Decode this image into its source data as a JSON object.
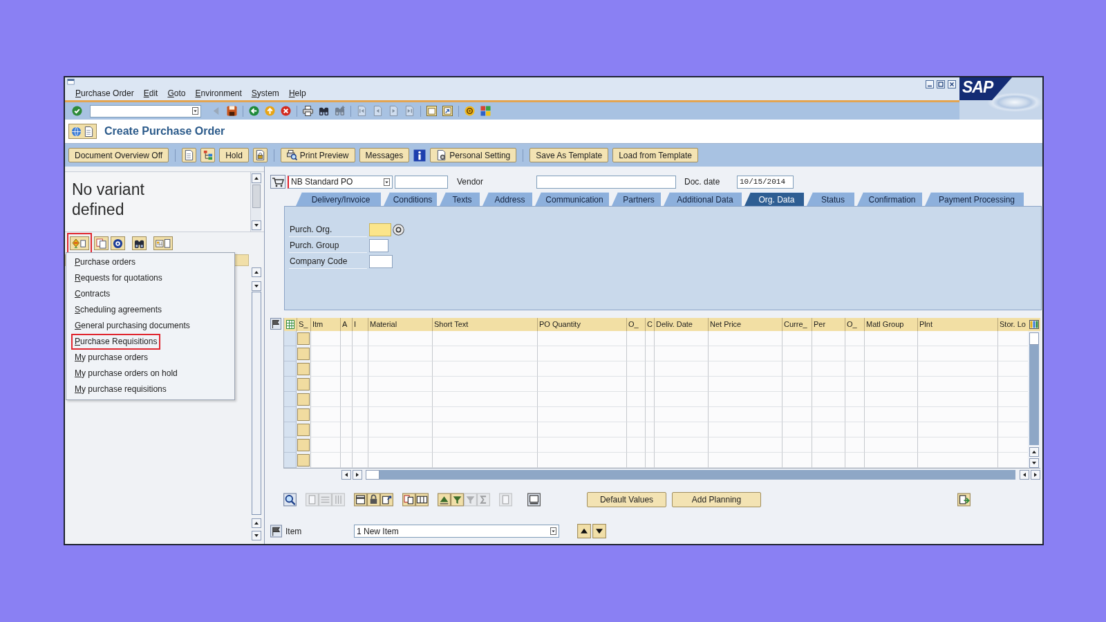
{
  "window": {
    "menu": [
      "Purchase Order",
      "Edit",
      "Goto",
      "Environment",
      "System",
      "Help"
    ],
    "logo": "SAP"
  },
  "system_toolbar": [
    {
      "disabled": false
    },
    {
      "disabled": true
    },
    {
      "disabled": false
    },
    {
      "disabled": false
    },
    {
      "disabled": false
    },
    {
      "disabled": false
    },
    {
      "disabled": false
    },
    {
      "disabled": false
    },
    {
      "disabled": true
    },
    {
      "disabled": true
    },
    {
      "disabled": true
    },
    {
      "disabled": true
    },
    {
      "disabled": true
    },
    {
      "disabled": false
    },
    {
      "disabled": false
    },
    {
      "disabled": false
    },
    {
      "disabled": false
    }
  ],
  "title": "Create Purchase Order",
  "app_toolbar": [
    "Document Overview Off",
    "Hold",
    "Print Preview",
    "Messages",
    "Personal Setting",
    "Save As Template",
    "Load from Template"
  ],
  "variant_panel": {
    "message": "No variant defined"
  },
  "nav_toolbar": [
    {
      "highlighted": true
    },
    {
      "highlighted": false
    },
    {
      "highlighted": false
    },
    {
      "highlighted": false
    },
    {
      "highlighted": false
    }
  ],
  "nav_menu": [
    {
      "label": "Purchase orders",
      "highlighted": false
    },
    {
      "label": "Requests for quotations",
      "highlighted": false
    },
    {
      "label": "Contracts",
      "highlighted": false
    },
    {
      "label": "Scheduling agreements",
      "highlighted": false
    },
    {
      "label": "General purchasing documents",
      "highlighted": false
    },
    {
      "label": "Purchase Requisitions",
      "highlighted": true
    },
    {
      "label": "My purchase orders",
      "highlighted": false
    },
    {
      "label": "My purchase orders on hold",
      "highlighted": false
    },
    {
      "label": "My purchase requisitions",
      "highlighted": false
    }
  ],
  "header": {
    "document_type": "NB Standard PO",
    "vendor_label": "Vendor",
    "doc_date_label": "Doc. date",
    "doc_date": "10/15/2014"
  },
  "tabs": [
    {
      "label": "Delivery/Invoice",
      "selected": false
    },
    {
      "label": "Conditions",
      "selected": false
    },
    {
      "label": "Texts",
      "selected": false
    },
    {
      "label": "Address",
      "selected": false
    },
    {
      "label": "Communication",
      "selected": false
    },
    {
      "label": "Partners",
      "selected": false
    },
    {
      "label": "Additional Data",
      "selected": false
    },
    {
      "label": "Org. Data",
      "selected": true
    },
    {
      "label": "Status",
      "selected": false
    },
    {
      "label": "Confirmation",
      "selected": false
    },
    {
      "label": "Payment Processing",
      "selected": false
    }
  ],
  "org_data": [
    {
      "label": "Purch. Org.",
      "focused": true
    },
    {
      "label": "Purch. Group",
      "focused": false
    },
    {
      "label": "Company Code",
      "focused": false
    }
  ],
  "items_table": {
    "columns": [
      "S_",
      "Itm",
      "A",
      "I",
      "Material",
      "Short Text",
      "PO Quantity",
      "O_",
      "C",
      "Deliv. Date",
      "Net Price",
      "Curre_",
      "Per",
      "O_",
      "Matl Group",
      "Plnt",
      "Stor. Lo"
    ]
  },
  "item_toolbar": {
    "icons": [
      {
        "disabled": false
      },
      {
        "disabled": true
      },
      {
        "disabled": true
      },
      {
        "disabled": true
      },
      {
        "disabled": false
      },
      {
        "disabled": false
      },
      {
        "disabled": false
      },
      {
        "disabled": false
      },
      {
        "disabled": false
      },
      {
        "disabled": false
      },
      {
        "disabled": false
      },
      {
        "disabled": true
      },
      {
        "disabled": true
      },
      {
        "disabled": true
      },
      {
        "disabled": false
      }
    ],
    "buttons": [
      "Default Values",
      "Add Planning"
    ]
  },
  "item_selector": {
    "label": "Item",
    "value": "1 New Item"
  }
}
